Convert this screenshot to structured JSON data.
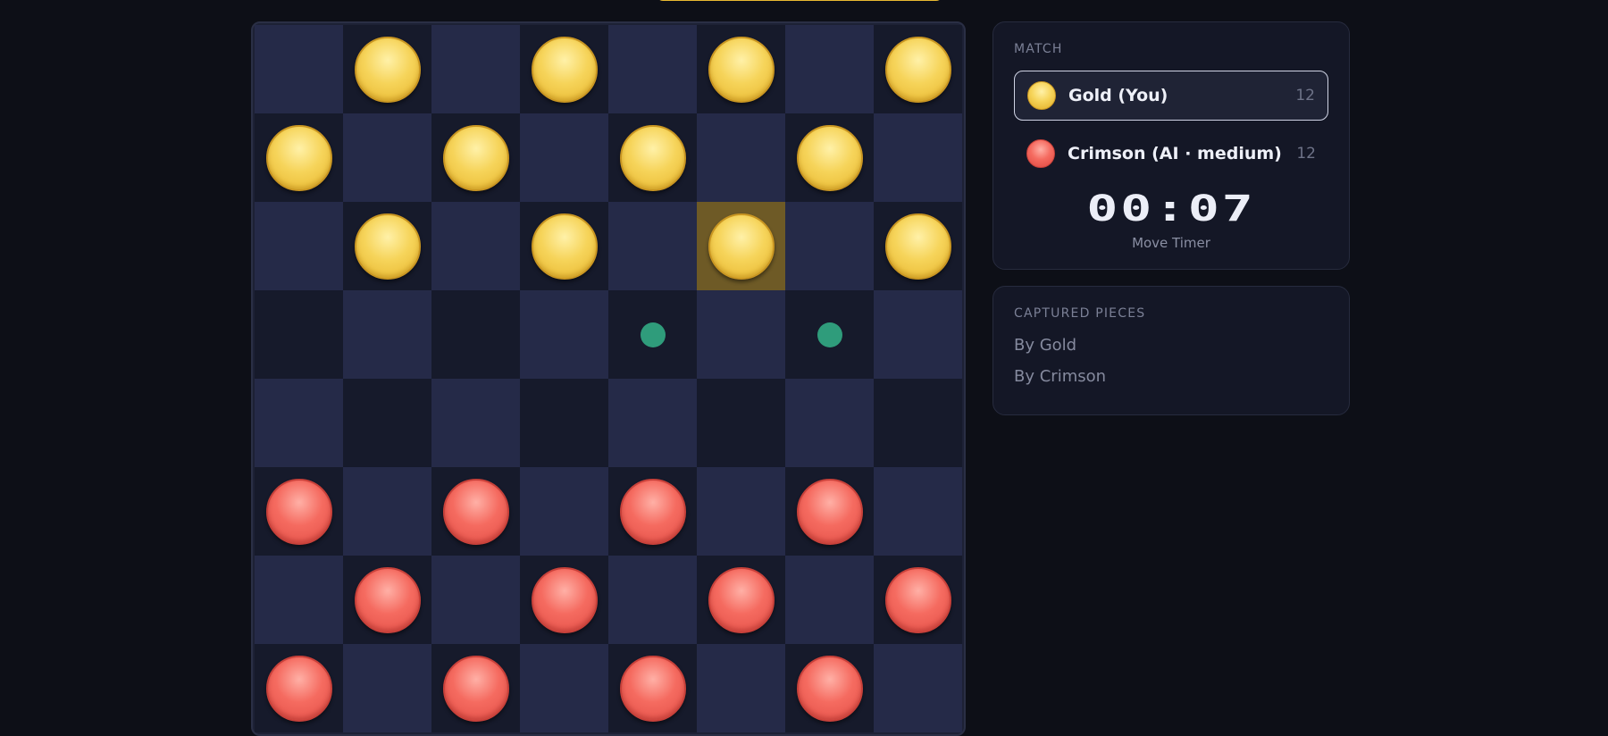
{
  "board": {
    "rows": [
      [
        "",
        "gold",
        "",
        "gold",
        "",
        "gold",
        "",
        "gold"
      ],
      [
        "gold",
        "",
        "gold",
        "",
        "gold",
        "",
        "gold",
        ""
      ],
      [
        "",
        "gold",
        "",
        "gold",
        "",
        "gold",
        "",
        "gold"
      ],
      [
        "",
        "",
        "",
        "",
        "",
        "",
        "",
        ""
      ],
      [
        "",
        "",
        "",
        "",
        "",
        "",
        "",
        ""
      ],
      [
        "crimson",
        "",
        "crimson",
        "",
        "crimson",
        "",
        "crimson",
        ""
      ],
      [
        "",
        "crimson",
        "",
        "crimson",
        "",
        "crimson",
        "",
        "crimson"
      ],
      [
        "crimson",
        "",
        "crimson",
        "",
        "crimson",
        "",
        "crimson",
        ""
      ]
    ],
    "selected": {
      "row": 2,
      "col": 5
    },
    "move_hints": [
      {
        "row": 3,
        "col": 4
      },
      {
        "row": 3,
        "col": 6
      }
    ]
  },
  "match": {
    "title": "MATCH",
    "players": [
      {
        "name": "Gold (You)",
        "count": "12",
        "color": "gold",
        "active": true
      },
      {
        "name": "Crimson (AI · medium)",
        "count": "12",
        "color": "crimson",
        "active": false
      }
    ],
    "timer": "00:07",
    "timer_label": "Move Timer"
  },
  "captured": {
    "title": "CAPTURED PIECES",
    "by_gold": "By Gold",
    "by_crimson": "By Crimson"
  },
  "colors": {
    "gold": "#f6d45a",
    "crimson": "#f56b60",
    "hint": "#2f9c7b",
    "selected": "#6e5a26"
  }
}
